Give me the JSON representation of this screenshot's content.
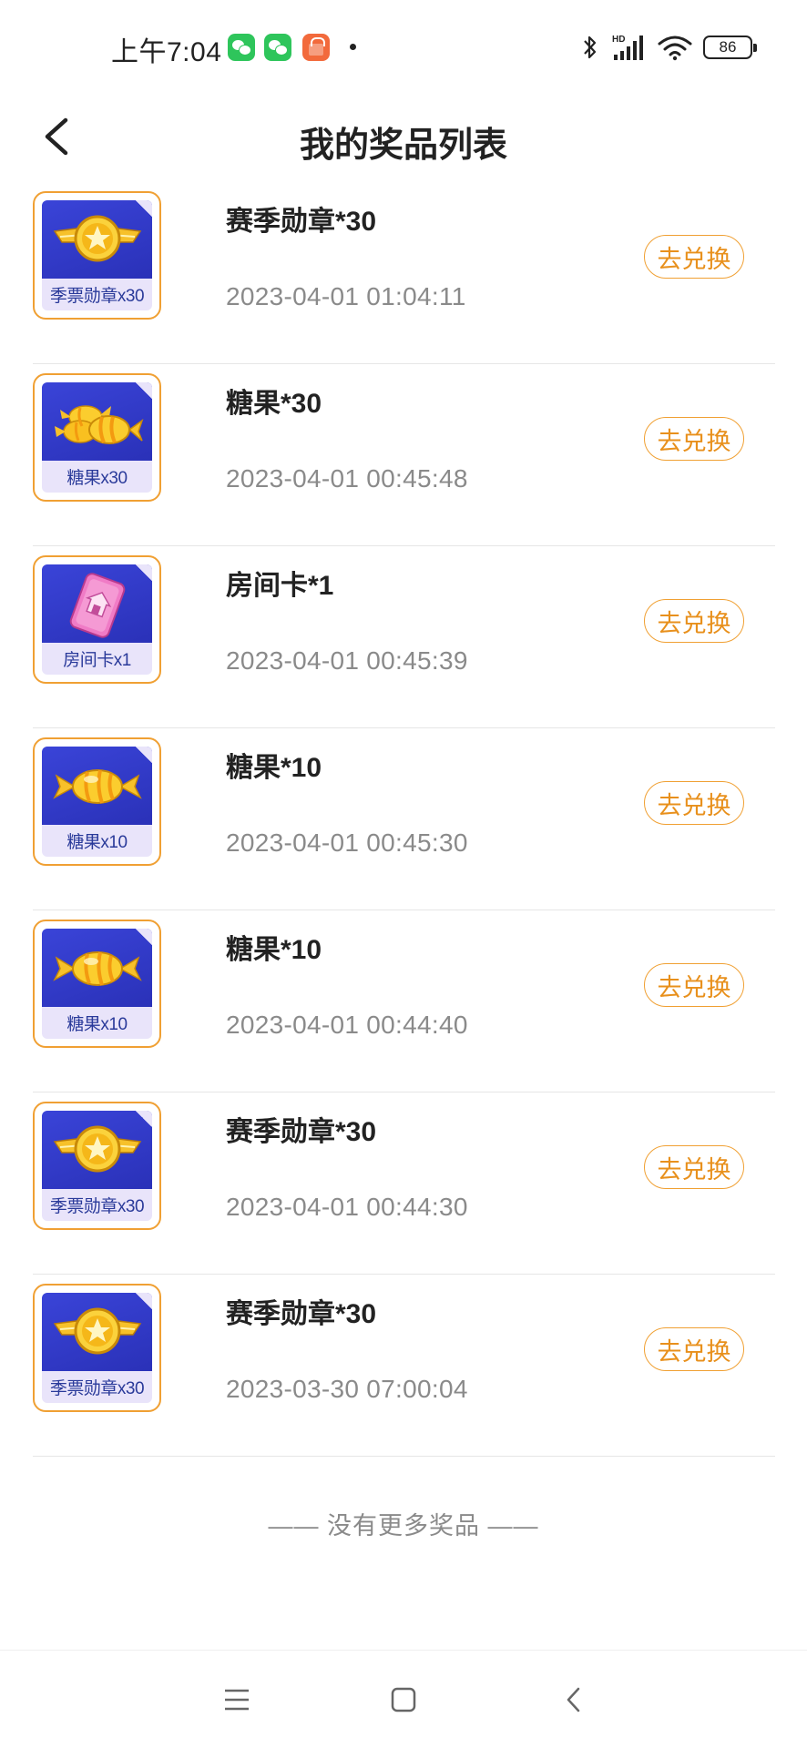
{
  "status_bar": {
    "time": "上午7:04",
    "battery": "86",
    "signal_label": "HD"
  },
  "header": {
    "title": "我的奖品列表"
  },
  "prizes": [
    {
      "name": "赛季勋章*30",
      "time": "2023-04-01 01:04:11",
      "thumb_label": "季票勋章x30",
      "icon": "medal-icon",
      "button": "去兑换"
    },
    {
      "name": "糖果*30",
      "time": "2023-04-01 00:45:48",
      "thumb_label": "糖果x30",
      "icon": "candy-pile-icon",
      "button": "去兑换"
    },
    {
      "name": "房间卡*1",
      "time": "2023-04-01 00:45:39",
      "thumb_label": "房间卡x1",
      "icon": "room-card-icon",
      "button": "去兑换"
    },
    {
      "name": "糖果*10",
      "time": "2023-04-01 00:45:30",
      "thumb_label": "糖果x10",
      "icon": "candy-icon",
      "button": "去兑换"
    },
    {
      "name": "糖果*10",
      "time": "2023-04-01 00:44:40",
      "thumb_label": "糖果x10",
      "icon": "candy-icon",
      "button": "去兑换"
    },
    {
      "name": "赛季勋章*30",
      "time": "2023-04-01 00:44:30",
      "thumb_label": "季票勋章x30",
      "icon": "medal-icon",
      "button": "去兑换"
    },
    {
      "name": "赛季勋章*30",
      "time": "2023-03-30 07:00:04",
      "thumb_label": "季票勋章x30",
      "icon": "medal-icon",
      "button": "去兑换"
    }
  ],
  "footer": {
    "no_more": "—— 没有更多奖品 ——"
  },
  "colors": {
    "accent": "#f0a033",
    "accent_text": "#e8901c",
    "card_blue": "#2f38c8"
  }
}
